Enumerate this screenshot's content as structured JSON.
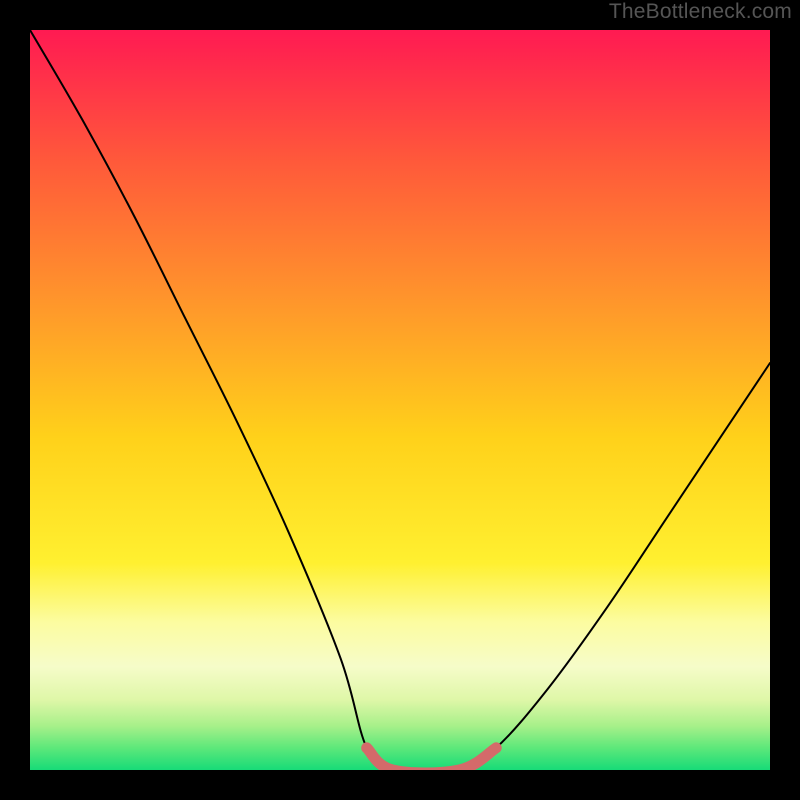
{
  "watermark": "TheBottleneck.com",
  "colors": {
    "frame": "#000000",
    "curve_stroke": "#000000",
    "pink_stroke": "#d46a6a",
    "gradient_stops": [
      {
        "offset": 0,
        "color": "#ff1a52"
      },
      {
        "offset": 0.18,
        "color": "#ff5a3a"
      },
      {
        "offset": 0.38,
        "color": "#ff9a2a"
      },
      {
        "offset": 0.55,
        "color": "#ffd11a"
      },
      {
        "offset": 0.72,
        "color": "#fff030"
      },
      {
        "offset": 0.8,
        "color": "#fcfca0"
      },
      {
        "offset": 0.86,
        "color": "#f6fcc9"
      },
      {
        "offset": 0.905,
        "color": "#dff7a8"
      },
      {
        "offset": 0.94,
        "color": "#a8f08a"
      },
      {
        "offset": 0.97,
        "color": "#5de87a"
      },
      {
        "offset": 1.0,
        "color": "#17db78"
      }
    ]
  },
  "chart_data": {
    "type": "line",
    "title": "",
    "xlabel": "",
    "ylabel": "",
    "xlim": [
      0,
      1
    ],
    "ylim": [
      0,
      100
    ],
    "grid": false,
    "series": [
      {
        "name": "bottleneck-curve",
        "x": [
          0.0,
          0.07,
          0.14,
          0.21,
          0.28,
          0.35,
          0.42,
          0.455,
          0.49,
          0.58,
          0.63,
          0.7,
          0.78,
          0.86,
          0.94,
          1.0
        ],
        "values": [
          100,
          88,
          75,
          61,
          47,
          32,
          15,
          3,
          0,
          0,
          3,
          11,
          22,
          34,
          46,
          55
        ]
      },
      {
        "name": "plateau-highlight",
        "x": [
          0.455,
          0.49,
          0.58,
          0.63
        ],
        "values": [
          3,
          0,
          0,
          3
        ]
      }
    ],
    "annotations": []
  }
}
